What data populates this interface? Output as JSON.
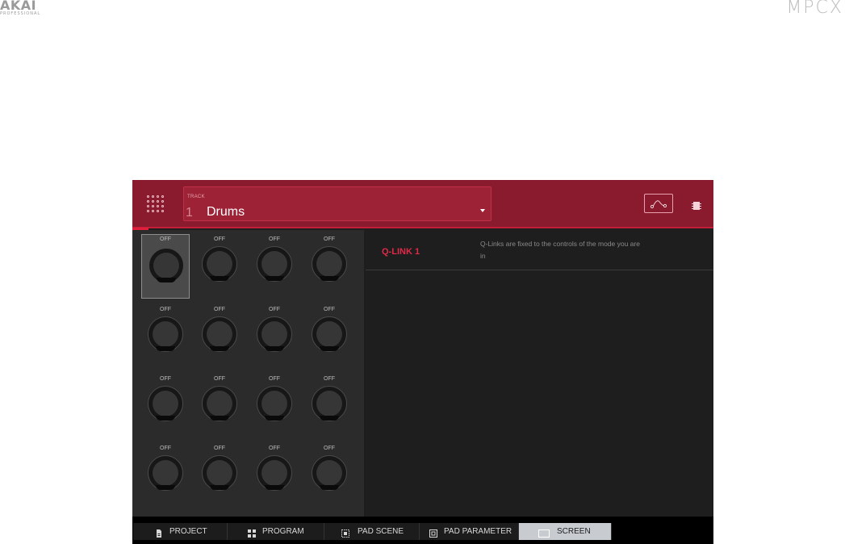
{
  "brand": {
    "left_logo": "AKAI",
    "left_sub": "PROFESSIONAL",
    "right_logo": "MPCX"
  },
  "header": {
    "track_label": "TRACK",
    "track_number": "1",
    "track_name": "Drums",
    "accent_color": "#8a1b2e",
    "highlight_color": "#e02a48"
  },
  "knobs": [
    {
      "label": "OFF",
      "selected": true
    },
    {
      "label": "OFF"
    },
    {
      "label": "OFF"
    },
    {
      "label": "OFF"
    },
    {
      "label": "OFF"
    },
    {
      "label": "OFF"
    },
    {
      "label": "OFF"
    },
    {
      "label": "OFF"
    },
    {
      "label": "OFF"
    },
    {
      "label": "OFF"
    },
    {
      "label": "OFF"
    },
    {
      "label": "OFF"
    },
    {
      "label": "OFF"
    },
    {
      "label": "OFF"
    },
    {
      "label": "OFF"
    },
    {
      "label": "OFF"
    }
  ],
  "info": {
    "qlink_title": "Q-LINK 1",
    "description": "Q-Links are fixed to the controls of the mode you are in"
  },
  "tabs": [
    {
      "label": "PROJECT",
      "icon": "project-icon"
    },
    {
      "label": "PROGRAM",
      "icon": "program-icon"
    },
    {
      "label": "PAD SCENE",
      "icon": "pad-scene-icon"
    },
    {
      "label": "PAD PARAMETER",
      "icon": "pad-parameter-icon"
    },
    {
      "label": "SCREEN",
      "icon": "screen-icon",
      "active": true
    }
  ]
}
